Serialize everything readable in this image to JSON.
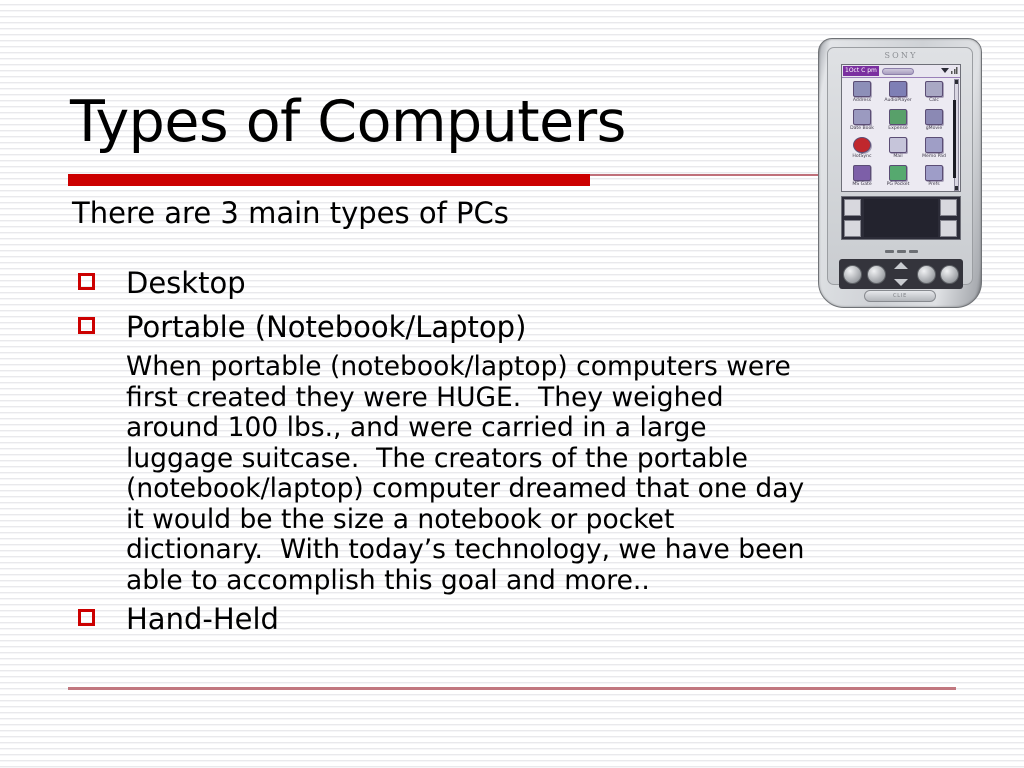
{
  "slide": {
    "title": "Types of Computers",
    "subtitle": "There are 3 main types of PCs",
    "accent_color": "#cc0000",
    "rule_color": "#c1777f",
    "bullets": [
      {
        "label": "Desktop"
      },
      {
        "label": "Portable (Notebook/Laptop)"
      },
      {
        "label": "Hand-Held"
      }
    ],
    "paragraph_lines": [
      "When portable (notebook/laptop) computers were",
      "first created they were HUGE.  They weighed",
      "around 100 lbs., and were carried in a large",
      "luggage suitcase.  The creators of the portable",
      "(notebook/laptop) computer dreamed that one day",
      "it would be the size a notebook or pocket",
      "dictionary.  With today’s technology, we have been",
      "able to accomplish this goal and more.."
    ]
  },
  "pda": {
    "brand": "SONY",
    "status_time": "1Oct C pm",
    "chin_label": "CLIE",
    "apps": [
      {
        "name": "Address",
        "icon": "address-book-icon",
        "color": "#8d8fb8"
      },
      {
        "name": "AudioPlayer",
        "icon": "audio-player-icon",
        "color": "#7e7fb5"
      },
      {
        "name": "Calc",
        "icon": "calculator-icon",
        "color": "#a9a8c4"
      },
      {
        "name": "Date Book",
        "icon": "calendar-icon",
        "color": "#9b9ac0"
      },
      {
        "name": "Expense",
        "icon": "expense-icon",
        "color": "#58a06a"
      },
      {
        "name": "gMovie",
        "icon": "movie-icon",
        "color": "#8b89b4"
      },
      {
        "name": "HotSync",
        "icon": "hotsync-icon",
        "color": "#c0272d"
      },
      {
        "name": "Mail",
        "icon": "mail-icon",
        "color": "#c6c5da"
      },
      {
        "name": "Memo Pad",
        "icon": "memo-pad-icon",
        "color": "#9f9ec6"
      },
      {
        "name": "MS Gate",
        "icon": "memory-stick-icon",
        "color": "#7d5fa8"
      },
      {
        "name": "PG Pocket",
        "icon": "picture-gear-icon",
        "color": "#56a96f"
      },
      {
        "name": "Prefs",
        "icon": "preferences-icon",
        "color": "#9e9dc8"
      }
    ]
  }
}
